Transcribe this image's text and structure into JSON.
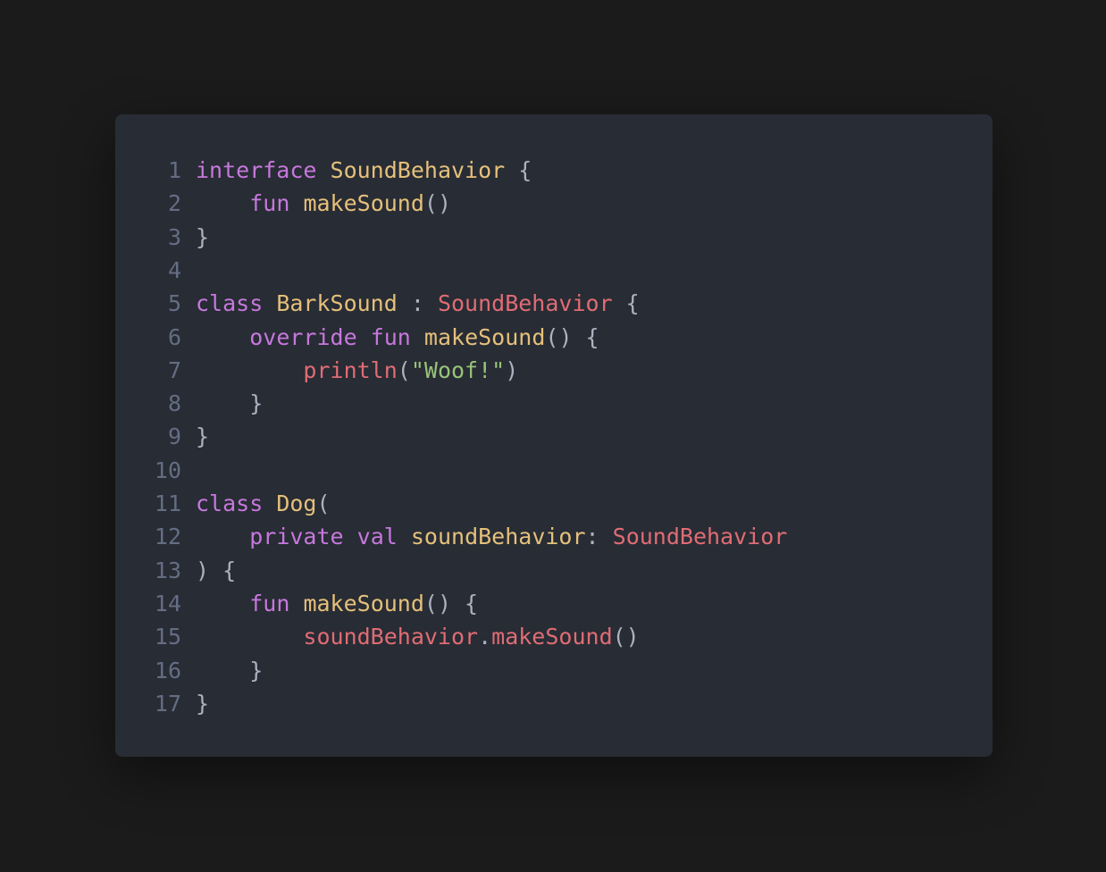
{
  "editor": {
    "colors": {
      "background": "#1b1b1b",
      "card": "#282c34",
      "line_number": "#636d83",
      "keyword": "#c678dd",
      "type": "#e5c07b",
      "type_ref": "#e06c75",
      "string": "#98c379",
      "punctuation": "#abb2bf"
    },
    "language": "kotlin",
    "lines": [
      {
        "number": "1",
        "tokens": [
          {
            "text": "interface",
            "kind": "keyword"
          },
          {
            "text": " ",
            "kind": "plain"
          },
          {
            "text": "SoundBehavior",
            "kind": "type"
          },
          {
            "text": " {",
            "kind": "punct"
          }
        ]
      },
      {
        "number": "2",
        "tokens": [
          {
            "text": "    ",
            "kind": "plain"
          },
          {
            "text": "fun",
            "kind": "keyword"
          },
          {
            "text": " ",
            "kind": "plain"
          },
          {
            "text": "makeSound",
            "kind": "type"
          },
          {
            "text": "()",
            "kind": "punct"
          }
        ]
      },
      {
        "number": "3",
        "tokens": [
          {
            "text": "}",
            "kind": "punct"
          }
        ]
      },
      {
        "number": "4",
        "tokens": []
      },
      {
        "number": "5",
        "tokens": [
          {
            "text": "class",
            "kind": "keyword"
          },
          {
            "text": " ",
            "kind": "plain"
          },
          {
            "text": "BarkSound",
            "kind": "type"
          },
          {
            "text": " : ",
            "kind": "punct"
          },
          {
            "text": "SoundBehavior",
            "kind": "type-ref"
          },
          {
            "text": " {",
            "kind": "punct"
          }
        ]
      },
      {
        "number": "6",
        "tokens": [
          {
            "text": "    ",
            "kind": "plain"
          },
          {
            "text": "override",
            "kind": "keyword"
          },
          {
            "text": " ",
            "kind": "plain"
          },
          {
            "text": "fun",
            "kind": "keyword"
          },
          {
            "text": " ",
            "kind": "plain"
          },
          {
            "text": "makeSound",
            "kind": "type"
          },
          {
            "text": "() {",
            "kind": "punct"
          }
        ]
      },
      {
        "number": "7",
        "tokens": [
          {
            "text": "        ",
            "kind": "plain"
          },
          {
            "text": "println",
            "kind": "call"
          },
          {
            "text": "(",
            "kind": "punct"
          },
          {
            "text": "\"Woof!\"",
            "kind": "string"
          },
          {
            "text": ")",
            "kind": "punct"
          }
        ]
      },
      {
        "number": "8",
        "tokens": [
          {
            "text": "    ",
            "kind": "plain"
          },
          {
            "text": "}",
            "kind": "punct"
          }
        ]
      },
      {
        "number": "9",
        "tokens": [
          {
            "text": "}",
            "kind": "punct"
          }
        ]
      },
      {
        "number": "10",
        "tokens": []
      },
      {
        "number": "11",
        "tokens": [
          {
            "text": "class",
            "kind": "keyword"
          },
          {
            "text": " ",
            "kind": "plain"
          },
          {
            "text": "Dog",
            "kind": "type"
          },
          {
            "text": "(",
            "kind": "punct"
          }
        ]
      },
      {
        "number": "12",
        "tokens": [
          {
            "text": "    ",
            "kind": "plain"
          },
          {
            "text": "private",
            "kind": "keyword"
          },
          {
            "text": " ",
            "kind": "plain"
          },
          {
            "text": "val",
            "kind": "keyword"
          },
          {
            "text": " ",
            "kind": "plain"
          },
          {
            "text": "soundBehavior",
            "kind": "type"
          },
          {
            "text": ": ",
            "kind": "punct"
          },
          {
            "text": "SoundBehavior",
            "kind": "type-ref"
          }
        ]
      },
      {
        "number": "13",
        "tokens": [
          {
            "text": ") {",
            "kind": "punct"
          }
        ]
      },
      {
        "number": "14",
        "tokens": [
          {
            "text": "    ",
            "kind": "plain"
          },
          {
            "text": "fun",
            "kind": "keyword"
          },
          {
            "text": " ",
            "kind": "plain"
          },
          {
            "text": "makeSound",
            "kind": "type"
          },
          {
            "text": "() {",
            "kind": "punct"
          }
        ]
      },
      {
        "number": "15",
        "tokens": [
          {
            "text": "        ",
            "kind": "plain"
          },
          {
            "text": "soundBehavior",
            "kind": "call"
          },
          {
            "text": ".",
            "kind": "punct"
          },
          {
            "text": "makeSound",
            "kind": "call"
          },
          {
            "text": "()",
            "kind": "punct"
          }
        ]
      },
      {
        "number": "16",
        "tokens": [
          {
            "text": "    ",
            "kind": "plain"
          },
          {
            "text": "}",
            "kind": "punct"
          }
        ]
      },
      {
        "number": "17",
        "tokens": [
          {
            "text": "}",
            "kind": "punct"
          }
        ]
      }
    ]
  }
}
